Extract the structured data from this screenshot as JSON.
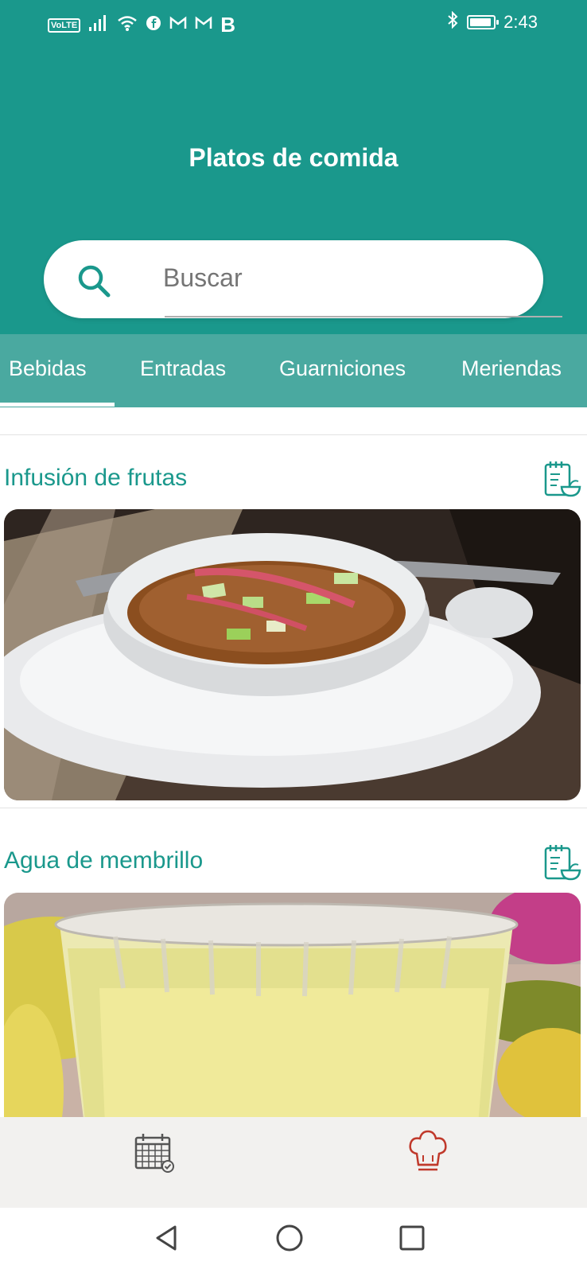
{
  "status_bar": {
    "volte": "VoLTE",
    "carrier_letter": "B",
    "time": "2:43"
  },
  "header": {
    "title": "Platos de comida"
  },
  "search": {
    "placeholder": "Buscar"
  },
  "tabs": [
    {
      "label": "Bebidas",
      "selected": true
    },
    {
      "label": "Entradas",
      "selected": false
    },
    {
      "label": "Guarniciones",
      "selected": false
    },
    {
      "label": "Meriendas",
      "selected": false
    }
  ],
  "recipes": [
    {
      "title": "Infusión de frutas",
      "image": "fruit-infusion-bowl-photo"
    },
    {
      "title": "Agua de membrillo",
      "image": "quince-water-glass-bowl-photo"
    }
  ],
  "bottom_nav": {
    "items": [
      {
        "icon": "calendar-icon",
        "active": false
      },
      {
        "icon": "chef-hat-icon",
        "active": true
      }
    ]
  },
  "colors": {
    "header": "#1a988c",
    "tabs_bar": "#4aa9a0",
    "accent_text": "#1a988c",
    "active_nav": "#c0392b",
    "inactive_nav": "#555555"
  }
}
